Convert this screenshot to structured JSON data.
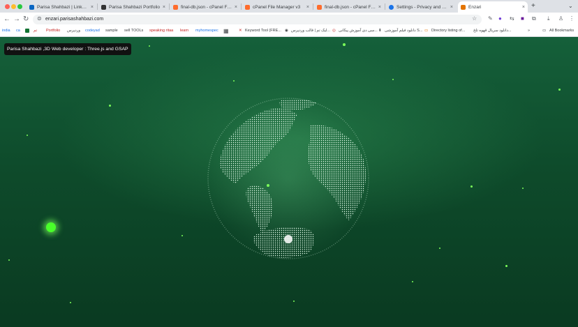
{
  "tabs": [
    {
      "title": "Parisa Shahbazi | LinkedIn",
      "favicon_color": "#0a66c2"
    },
    {
      "title": "Parisa Shahbazi Portfolio",
      "favicon_color": "#333333"
    },
    {
      "title": "final-db.json - cPanel File Ma",
      "favicon_color": "#ff6c2c"
    },
    {
      "title": "cPanel File Manager v3",
      "favicon_color": "#ff6c2c"
    },
    {
      "title": "final-db.json - cPanel File Ma",
      "favicon_color": "#ff6c2c"
    },
    {
      "title": "Settings - Privacy and securi",
      "favicon_color": "#1a73e8"
    },
    {
      "title": "Enzari",
      "favicon_color": "#e37400",
      "active": true
    }
  ],
  "toolbar": {
    "url": "enzari.parisashahbazi.com"
  },
  "bookmarks": [
    {
      "label": "india",
      "color": "#1a73e8"
    },
    {
      "label": "ca",
      "color": "#1a73e8"
    },
    {
      "label": "تم",
      "color": "#c5221f"
    },
    {
      "label": "Portfolio",
      "color": "#c5221f"
    },
    {
      "label": "وردپرس",
      "color": "#3c4043"
    },
    {
      "label": "codeyad",
      "color": "#1a73e8"
    },
    {
      "label": "sample",
      "color": "#3c4043"
    },
    {
      "label": "sell TOOLs",
      "color": "#3c4043"
    },
    {
      "label": "speaking ritaa",
      "color": "#c5221f"
    },
    {
      "label": "learn",
      "color": "#c5221f"
    },
    {
      "label": "myhomespec",
      "color": "#1a73e8"
    },
    {
      "label": "Keyword Tool (FRE...",
      "color": "#3c4043"
    },
    {
      "label": "لیک تم | قالب وردپرس...",
      "color": "#3c4043"
    },
    {
      "label": "سی دی آموزش پیکانی...",
      "color": "#3c4043"
    },
    {
      "label": "دانلود فیلم آموزشی S...",
      "color": "#3c4043"
    },
    {
      "label": "Directory listing of...",
      "color": "#3c4043"
    },
    {
      "label": "دانلود سریال قهوه تلخ...",
      "color": "#3c4043"
    },
    {
      "label": "All Bookmarks",
      "color": "#3c4043"
    }
  ],
  "page": {
    "tooltip": "Parisa Shahbazi ,3D Web developer : Three.js and GSAP"
  },
  "colors": {
    "background": "#0e4b2b",
    "particles": "#7CFF5A",
    "globe": "#e8ffee"
  },
  "icons": [
    "back-icon",
    "forward-icon",
    "reload-icon",
    "site-info-icon",
    "star-icon",
    "extension-icon",
    "download-icon",
    "more-icon",
    "apps-grid-icon",
    "folder-icon"
  ]
}
